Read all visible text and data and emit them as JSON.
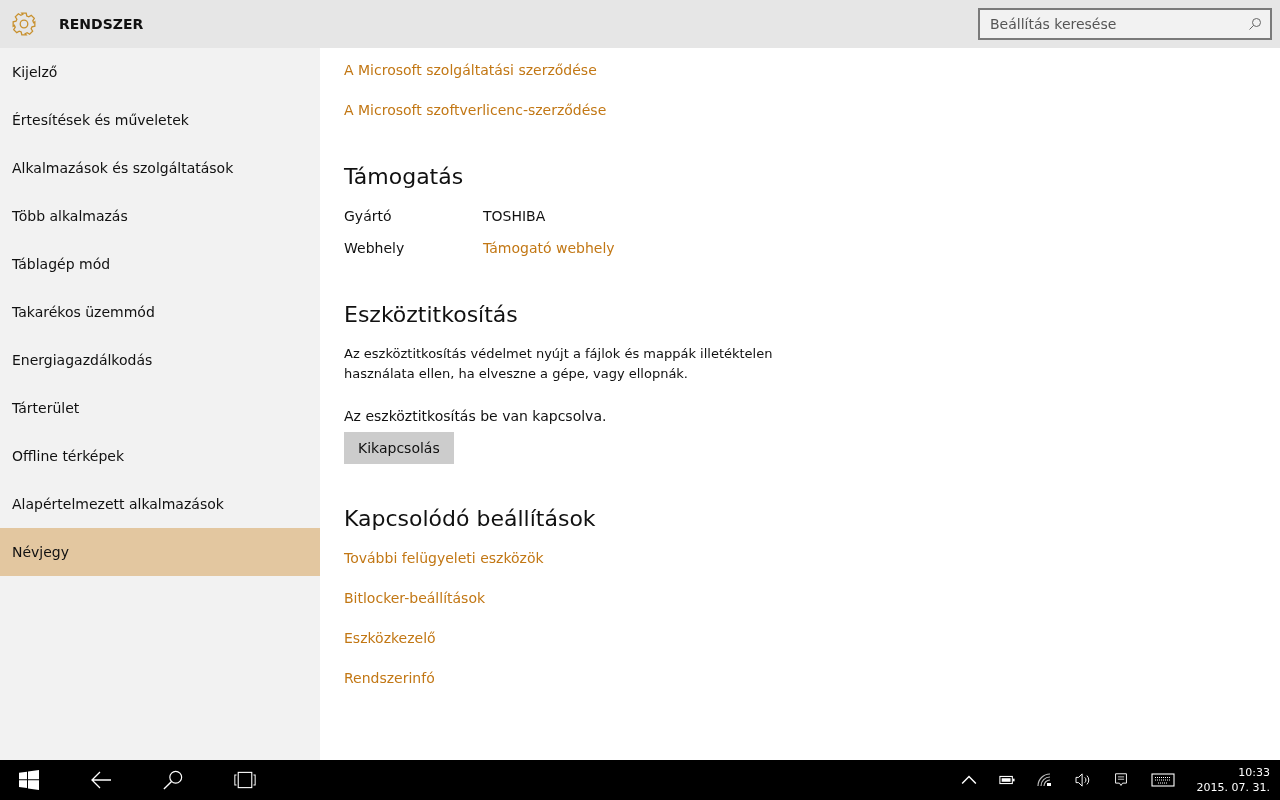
{
  "header": {
    "title": "RENDSZER",
    "search": {
      "placeholder": "Beállítás keresése"
    }
  },
  "sidebar": {
    "items": [
      {
        "label": "Kijelző",
        "selected": false
      },
      {
        "label": "Értesítések és műveletek",
        "selected": false
      },
      {
        "label": "Alkalmazások és szolgáltatások",
        "selected": false
      },
      {
        "label": "Több alkalmazás",
        "selected": false
      },
      {
        "label": "Táblagép mód",
        "selected": false
      },
      {
        "label": "Takarékos üzemmód",
        "selected": false
      },
      {
        "label": "Energiagazdálkodás",
        "selected": false
      },
      {
        "label": "Tárterület",
        "selected": false
      },
      {
        "label": "Offline térképek",
        "selected": false
      },
      {
        "label": "Alapértelmezett alkalmazások",
        "selected": false
      },
      {
        "label": "Névjegy",
        "selected": true
      }
    ]
  },
  "content": {
    "top_links": [
      "A Microsoft szolgáltatási szerződése",
      "A Microsoft szoftverlicenc-szerződése"
    ],
    "support": {
      "heading": "Támogatás",
      "rows": [
        {
          "label": "Gyártó",
          "value": "TOSHIBA",
          "kind": "text"
        },
        {
          "label": "Webhely",
          "value": "Támogató webhely",
          "kind": "link"
        }
      ]
    },
    "encryption": {
      "heading": "Eszköztitkosítás",
      "description": "Az eszköztitkosítás védelmet nyújt a fájlok és mappák illetéktelen használata ellen, ha elveszne a gépe, vagy ellopnák.",
      "status": "Az eszköztitkosítás be van kapcsolva.",
      "button": "Kikapcsolás"
    },
    "related": {
      "heading": "Kapcsolódó beállítások",
      "links": [
        "További felügyeleti eszközök",
        "Bitlocker-beállítások",
        "Eszközkezelő",
        "Rendszerinfó"
      ]
    }
  },
  "taskbar": {
    "time": "10:33",
    "date": "2015. 07. 31."
  }
}
